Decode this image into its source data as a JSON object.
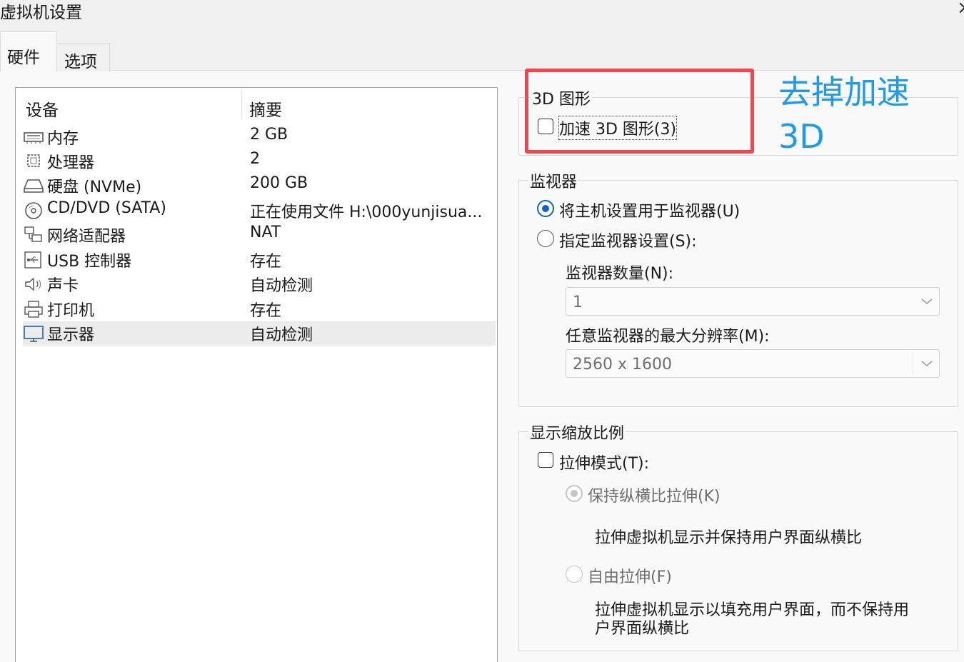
{
  "window": {
    "title": "虚拟机设置",
    "close_icon": "close-icon"
  },
  "tabs": [
    {
      "label": "硬件",
      "active": true
    },
    {
      "label": "选项",
      "active": false
    }
  ],
  "device_table": {
    "headers": [
      "设备",
      "摘要"
    ],
    "rows": [
      {
        "name": "内存",
        "summary": "2 GB",
        "icon": "memory-icon",
        "selected": false
      },
      {
        "name": "处理器",
        "summary": "2",
        "icon": "cpu-icon",
        "selected": false
      },
      {
        "name": "硬盘 (NVMe)",
        "summary": "200 GB",
        "icon": "hard-disk-icon",
        "selected": false
      },
      {
        "name": "CD/DVD (SATA)",
        "summary": "正在使用文件 H:\\000yunjisua...",
        "icon": "cd-dvd-icon",
        "selected": false
      },
      {
        "name": "网络适配器",
        "summary": "NAT",
        "icon": "network-adapter-icon",
        "selected": false
      },
      {
        "name": "USB 控制器",
        "summary": "存在",
        "icon": "usb-icon",
        "selected": false
      },
      {
        "name": "声卡",
        "summary": "自动检测",
        "icon": "speaker-icon",
        "selected": false
      },
      {
        "name": "打印机",
        "summary": "存在",
        "icon": "printer-icon",
        "selected": false
      },
      {
        "name": "显示器",
        "summary": "自动检测",
        "icon": "monitor-icon",
        "selected": true
      }
    ]
  },
  "graphics_3d": {
    "group_label": "3D 图形",
    "accelerate_label": "加速 3D 图形(3)",
    "accelerate_checked": false
  },
  "monitors": {
    "group_label": "监视器",
    "use_host_label": "将主机设置用于监视器(U)",
    "use_host_selected": true,
    "specify_label": "指定监视器设置(S):",
    "count_label": "监视器数量(N):",
    "count_value": "1",
    "max_res_label": "任意监视器的最大分辨率(M):",
    "max_res_value": "2560 x 1600"
  },
  "scaling": {
    "group_label": "显示缩放比例",
    "stretch_label": "拉伸模式(T):",
    "stretch_checked": false,
    "keep_aspect_label": "保持纵横比拉伸(K)",
    "keep_aspect_desc": "拉伸虚拟机显示并保持用户界面纵横比",
    "free_label": "自由拉伸(F)",
    "free_desc_line1": "拉伸虚拟机显示以填充用户界面，而不保持用",
    "free_desc_line2": "户界面纵横比"
  },
  "annotation": {
    "line1": "去掉加速",
    "line2": "3D",
    "text_color": "#1e9ae6",
    "box_color": "#f0474f"
  }
}
